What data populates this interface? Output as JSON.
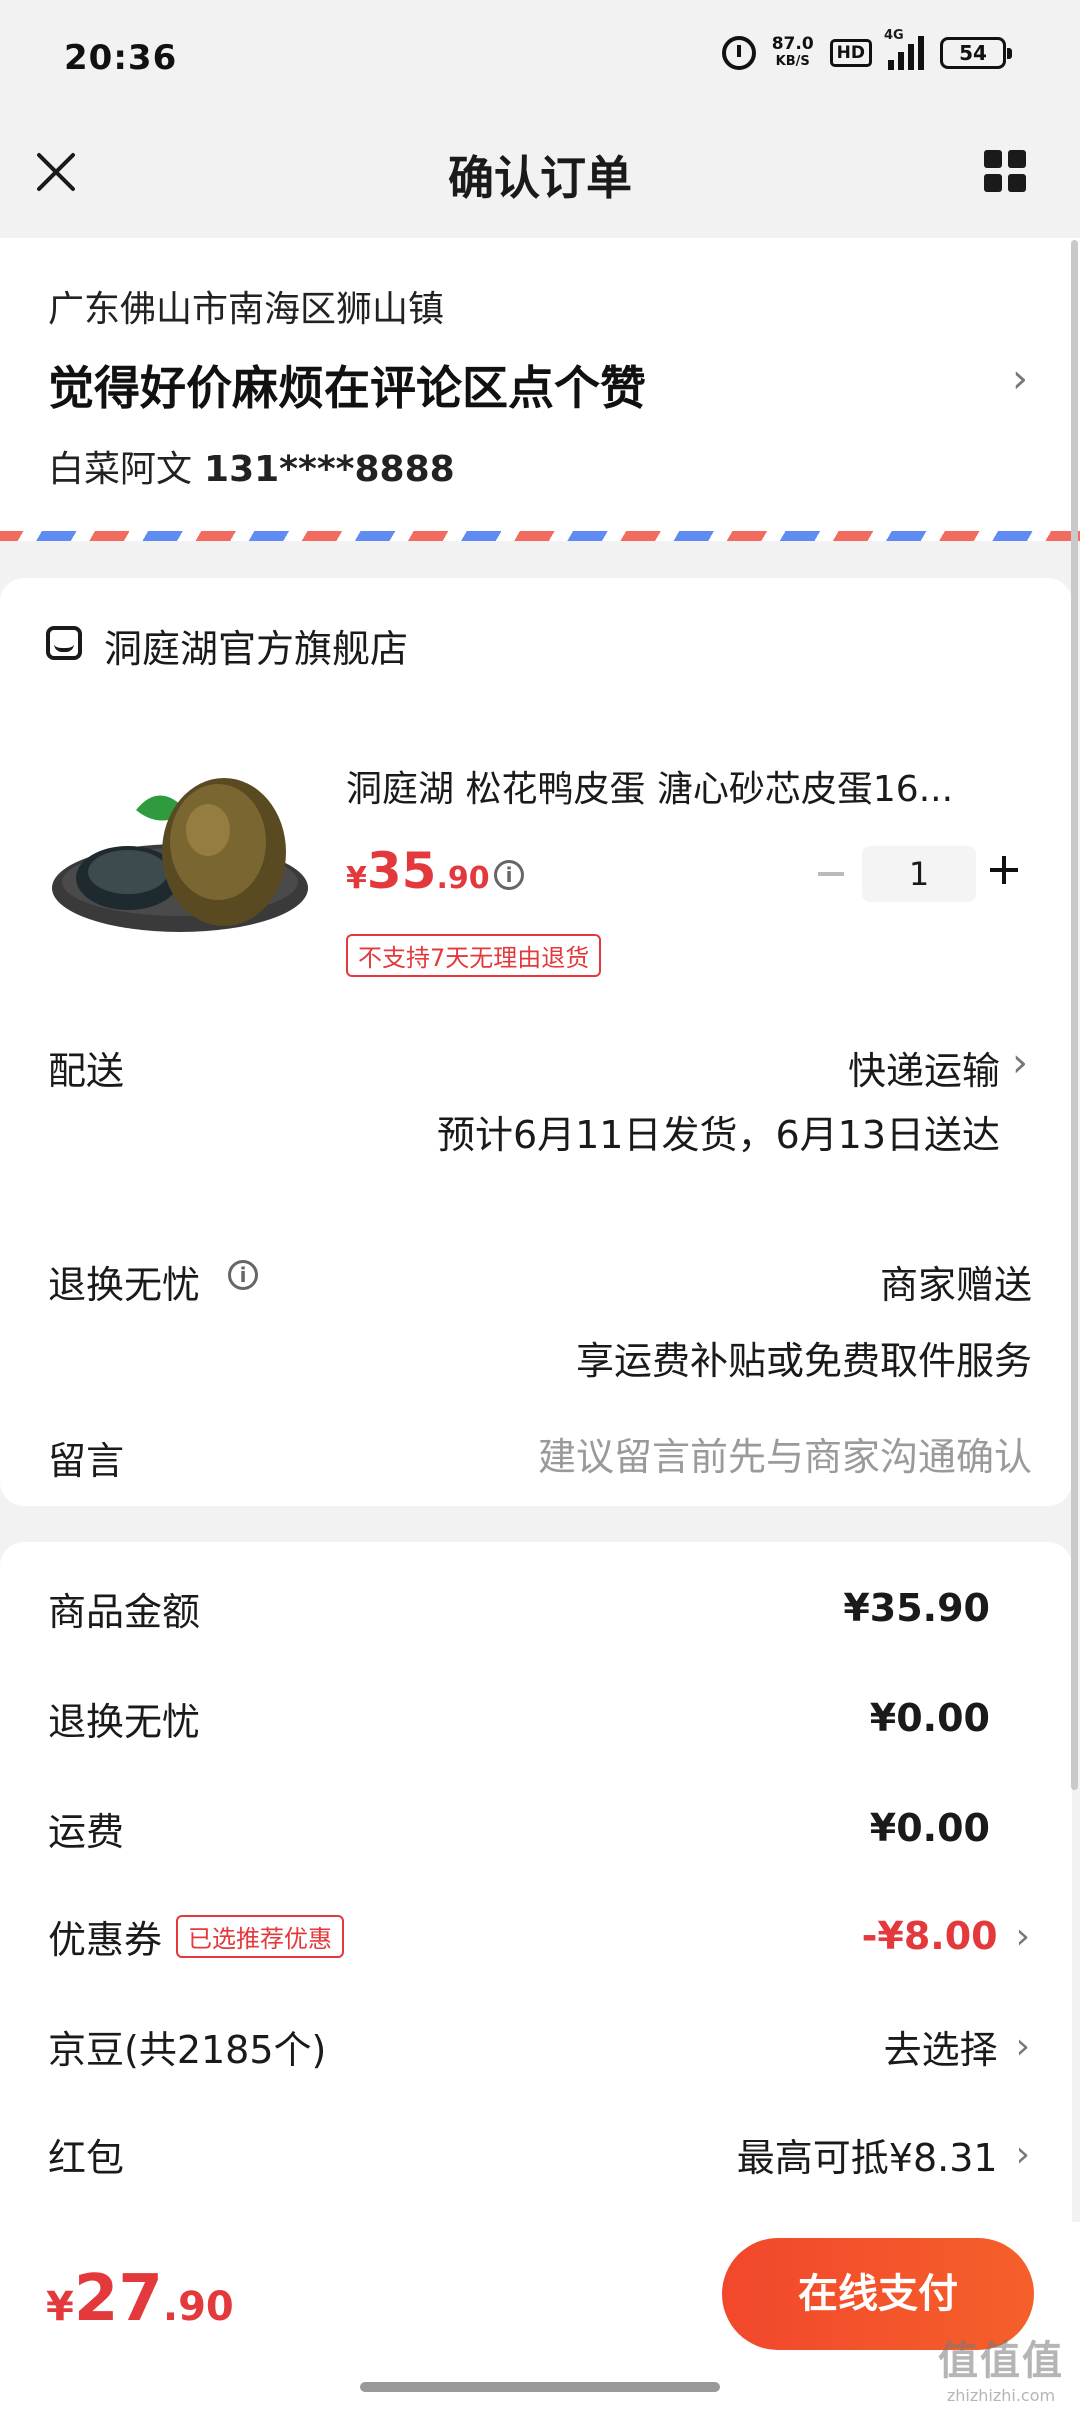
{
  "status_bar": {
    "time": "20:36",
    "net_speed_value": "87.0",
    "net_speed_unit": "KB/S",
    "hd": "HD",
    "network": "4G",
    "battery": "54"
  },
  "header": {
    "title": "确认订单",
    "close_icon": "close-icon",
    "menu_icon": "grid-menu-icon"
  },
  "address": {
    "region": "广东佛山市南海区狮山镇",
    "detail": "觉得好价麻烦在评论区点个赞",
    "name": "白菜阿文",
    "phone": "131****8888"
  },
  "shop": {
    "name": "洞庭湖官方旗舰店",
    "product": {
      "title": "洞庭湖 松花鸭皮蛋 溏心砂芯皮蛋16...",
      "price_symbol": "¥",
      "price_int": "35",
      "price_dec": ".90",
      "quantity": "1",
      "tag": "不支持7天无理由退货"
    },
    "delivery": {
      "label": "配送",
      "method": "快递运输",
      "eta": "预计6月11日发货，6月13日送达"
    },
    "worry_free": {
      "label": "退换无忧",
      "value": "商家赠送",
      "desc": "享运费补贴或免费取件服务"
    },
    "message": {
      "label": "留言",
      "placeholder": "建议留言前先与商家沟通确认"
    }
  },
  "summary": {
    "goods_label": "商品金额",
    "goods_value": "¥35.90",
    "worry_label": "退换无忧",
    "worry_value": "¥0.00",
    "shipping_label": "运费",
    "shipping_value": "¥0.00",
    "coupon_label": "优惠券",
    "coupon_tag": "已选推荐优惠",
    "coupon_value": "-¥8.00",
    "jd_beans_label": "京豆(共2185个)",
    "jd_beans_value": "去选择",
    "red_packet_label": "红包",
    "red_packet_value": "最高可抵¥8.31"
  },
  "bottom": {
    "total_symbol": "¥",
    "total_int": "27",
    "total_dec": ".90",
    "pay_label": "在线支付"
  },
  "watermark": {
    "logo": "值值值",
    "site": "zhizhizhi.com"
  },
  "colors": {
    "accent_red": "#e4393c",
    "pay_gradient_start": "#f2472c",
    "pay_gradient_end": "#f5602a",
    "background": "#f2f2f2"
  }
}
